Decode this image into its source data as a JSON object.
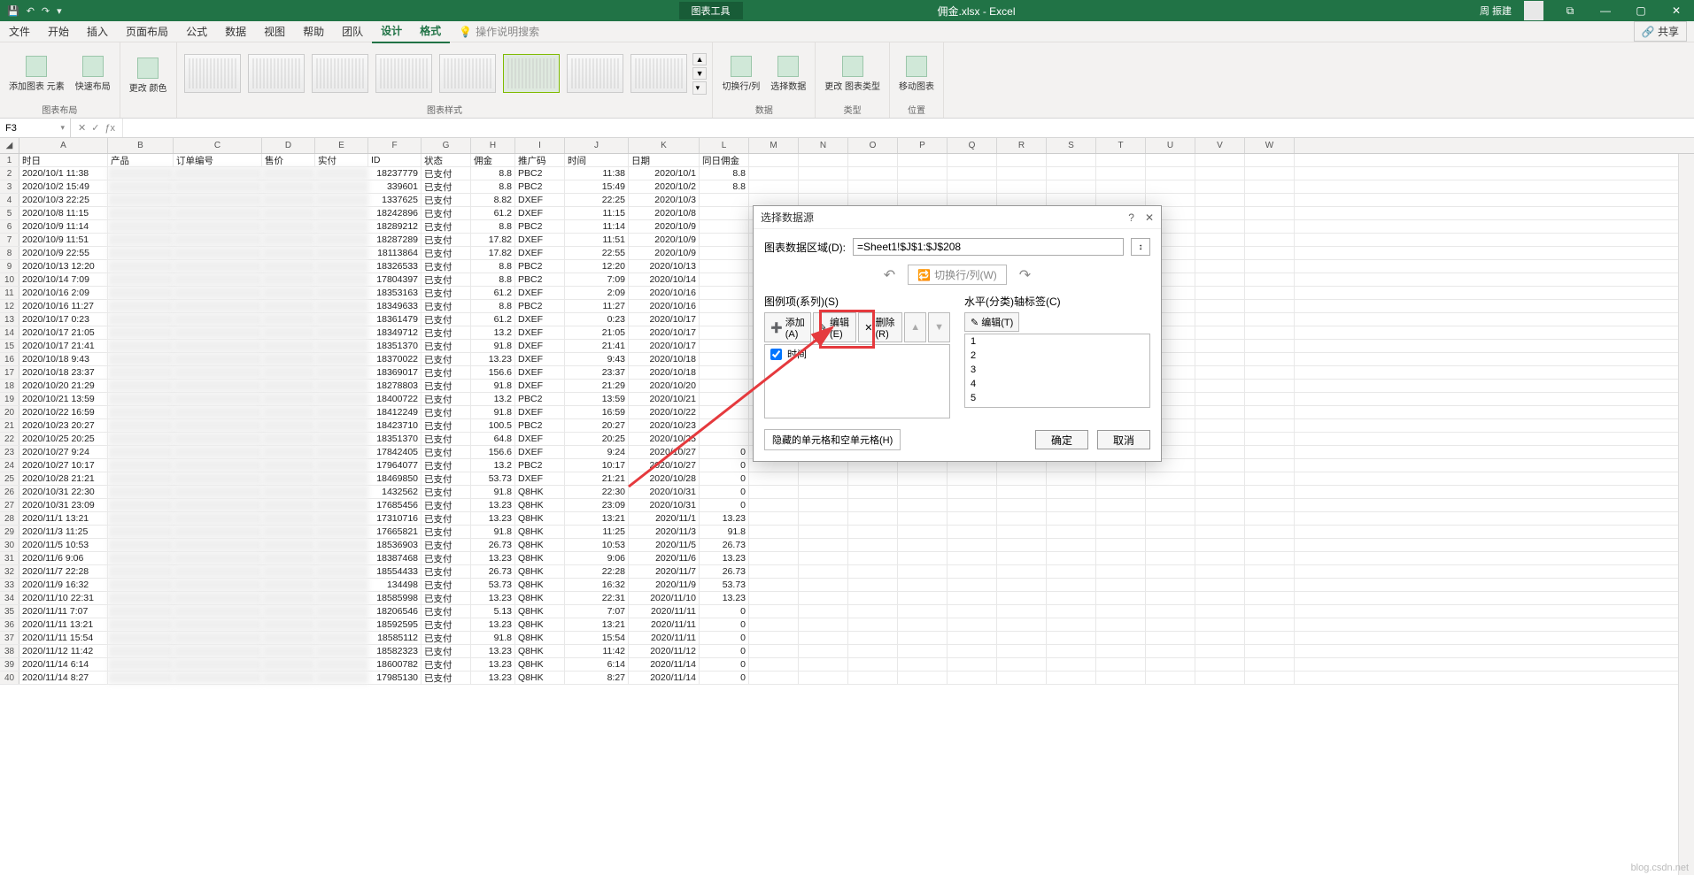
{
  "titlebar": {
    "chart_tool": "图表工具",
    "filename": "佣金.xlsx - Excel",
    "user": "周 振建",
    "win": {
      "min": "—",
      "max": "▢",
      "close": "✕",
      "restore": "⧉"
    }
  },
  "tabs": {
    "file": "文件",
    "home": "开始",
    "insert": "插入",
    "layout": "页面布局",
    "formula": "公式",
    "data": "数据",
    "view": "视图",
    "help": "帮助",
    "team": "团队",
    "design": "设计",
    "format": "格式",
    "tell_me": "操作说明搜索",
    "share": "共享"
  },
  "ribbon": {
    "grp_layout": "图表布局",
    "btn_add_el": "添加图表\n元素",
    "btn_quick": "快速布局",
    "btn_colors": "更改\n颜色",
    "grp_styles": "图表样式",
    "grp_data": "数据",
    "btn_switch": "切换行/列",
    "btn_select": "选择数据",
    "grp_type": "类型",
    "btn_change_type": "更改\n图表类型",
    "grp_loc": "位置",
    "btn_move": "移动图表"
  },
  "namebox": {
    "ref": "F3"
  },
  "columns": [
    "A",
    "B",
    "C",
    "D",
    "E",
    "F",
    "G",
    "H",
    "I",
    "J",
    "K",
    "L",
    "M",
    "N",
    "O",
    "P",
    "Q",
    "R",
    "S",
    "T",
    "U",
    "V",
    "W"
  ],
  "headers": {
    "A": "时日",
    "B": "产品",
    "C": "订单编号",
    "D": "售价",
    "E": "实付",
    "F": "ID",
    "G": "状态",
    "H": "佣金",
    "I": "推广码",
    "J": "时间",
    "K": "日期",
    "L": "同日佣金"
  },
  "rows": [
    {
      "n": 2,
      "A": "2020/10/1 11:38",
      "F": "18237779",
      "G": "已支付",
      "H": "8.8",
      "I": "PBC2",
      "J": "11:38",
      "K": "2020/10/1",
      "L": "8.8"
    },
    {
      "n": 3,
      "A": "2020/10/2 15:49",
      "F": "339601",
      "G": "已支付",
      "H": "8.8",
      "I": "PBC2",
      "J": "15:49",
      "K": "2020/10/2",
      "L": "8.8"
    },
    {
      "n": 4,
      "A": "2020/10/3 22:25",
      "F": "1337625",
      "G": "已支付",
      "H": "8.82",
      "I": "DXEF",
      "J": "22:25",
      "K": "2020/10/3",
      "L": ""
    },
    {
      "n": 5,
      "A": "2020/10/8 11:15",
      "F": "18242896",
      "G": "已支付",
      "H": "61.2",
      "I": "DXEF",
      "J": "11:15",
      "K": "2020/10/8",
      "L": ""
    },
    {
      "n": 6,
      "A": "2020/10/9 11:14",
      "F": "18289212",
      "G": "已支付",
      "H": "8.8",
      "I": "PBC2",
      "J": "11:14",
      "K": "2020/10/9",
      "L": ""
    },
    {
      "n": 7,
      "A": "2020/10/9 11:51",
      "F": "18287289",
      "G": "已支付",
      "H": "17.82",
      "I": "DXEF",
      "J": "11:51",
      "K": "2020/10/9",
      "L": ""
    },
    {
      "n": 8,
      "A": "2020/10/9 22:55",
      "F": "18113864",
      "G": "已支付",
      "H": "17.82",
      "I": "DXEF",
      "J": "22:55",
      "K": "2020/10/9",
      "L": ""
    },
    {
      "n": 9,
      "A": "2020/10/13 12:20",
      "F": "18326533",
      "G": "已支付",
      "H": "8.8",
      "I": "PBC2",
      "J": "12:20",
      "K": "2020/10/13",
      "L": ""
    },
    {
      "n": 10,
      "A": "2020/10/14 7:09",
      "F": "17804397",
      "G": "已支付",
      "H": "8.8",
      "I": "PBC2",
      "J": "7:09",
      "K": "2020/10/14",
      "L": ""
    },
    {
      "n": 11,
      "A": "2020/10/16 2:09",
      "F": "18353163",
      "G": "已支付",
      "H": "61.2",
      "I": "DXEF",
      "J": "2:09",
      "K": "2020/10/16",
      "L": ""
    },
    {
      "n": 12,
      "A": "2020/10/16 11:27",
      "F": "18349633",
      "G": "已支付",
      "H": "8.8",
      "I": "PBC2",
      "J": "11:27",
      "K": "2020/10/16",
      "L": ""
    },
    {
      "n": 13,
      "A": "2020/10/17 0:23",
      "F": "18361479",
      "G": "已支付",
      "H": "61.2",
      "I": "DXEF",
      "J": "0:23",
      "K": "2020/10/17",
      "L": ""
    },
    {
      "n": 14,
      "A": "2020/10/17 21:05",
      "F": "18349712",
      "G": "已支付",
      "H": "13.2",
      "I": "DXEF",
      "J": "21:05",
      "K": "2020/10/17",
      "L": ""
    },
    {
      "n": 15,
      "A": "2020/10/17 21:41",
      "F": "18351370",
      "G": "已支付",
      "H": "91.8",
      "I": "DXEF",
      "J": "21:41",
      "K": "2020/10/17",
      "L": ""
    },
    {
      "n": 16,
      "A": "2020/10/18 9:43",
      "F": "18370022",
      "G": "已支付",
      "H": "13.23",
      "I": "DXEF",
      "J": "9:43",
      "K": "2020/10/18",
      "L": ""
    },
    {
      "n": 17,
      "A": "2020/10/18 23:37",
      "F": "18369017",
      "G": "已支付",
      "H": "156.6",
      "I": "DXEF",
      "J": "23:37",
      "K": "2020/10/18",
      "L": ""
    },
    {
      "n": 18,
      "A": "2020/10/20 21:29",
      "F": "18278803",
      "G": "已支付",
      "H": "91.8",
      "I": "DXEF",
      "J": "21:29",
      "K": "2020/10/20",
      "L": ""
    },
    {
      "n": 19,
      "A": "2020/10/21 13:59",
      "F": "18400722",
      "G": "已支付",
      "H": "13.2",
      "I": "PBC2",
      "J": "13:59",
      "K": "2020/10/21",
      "L": ""
    },
    {
      "n": 20,
      "A": "2020/10/22 16:59",
      "F": "18412249",
      "G": "已支付",
      "H": "91.8",
      "I": "DXEF",
      "J": "16:59",
      "K": "2020/10/22",
      "L": ""
    },
    {
      "n": 21,
      "A": "2020/10/23 20:27",
      "F": "18423710",
      "G": "已支付",
      "H": "100.5",
      "I": "PBC2",
      "J": "20:27",
      "K": "2020/10/23",
      "L": ""
    },
    {
      "n": 22,
      "A": "2020/10/25 20:25",
      "F": "18351370",
      "G": "已支付",
      "H": "64.8",
      "I": "DXEF",
      "J": "20:25",
      "K": "2020/10/25",
      "L": ""
    },
    {
      "n": 23,
      "A": "2020/10/27 9:24",
      "F": "17842405",
      "G": "已支付",
      "H": "156.6",
      "I": "DXEF",
      "J": "9:24",
      "K": "2020/10/27",
      "L": "0"
    },
    {
      "n": 24,
      "A": "2020/10/27 10:17",
      "F": "17964077",
      "G": "已支付",
      "H": "13.2",
      "I": "PBC2",
      "J": "10:17",
      "K": "2020/10/27",
      "L": "0"
    },
    {
      "n": 25,
      "A": "2020/10/28 21:21",
      "F": "18469850",
      "G": "已支付",
      "H": "53.73",
      "I": "DXEF",
      "J": "21:21",
      "K": "2020/10/28",
      "L": "0"
    },
    {
      "n": 26,
      "A": "2020/10/31 22:30",
      "F": "1432562",
      "G": "已支付",
      "H": "91.8",
      "I": "Q8HK",
      "J": "22:30",
      "K": "2020/10/31",
      "L": "0"
    },
    {
      "n": 27,
      "A": "2020/10/31 23:09",
      "F": "17685456",
      "G": "已支付",
      "H": "13.23",
      "I": "Q8HK",
      "J": "23:09",
      "K": "2020/10/31",
      "L": "0"
    },
    {
      "n": 28,
      "A": "2020/11/1 13:21",
      "F": "17310716",
      "G": "已支付",
      "H": "13.23",
      "I": "Q8HK",
      "J": "13:21",
      "K": "2020/11/1",
      "L": "13.23"
    },
    {
      "n": 29,
      "A": "2020/11/3 11:25",
      "F": "17665821",
      "G": "已支付",
      "H": "91.8",
      "I": "Q8HK",
      "J": "11:25",
      "K": "2020/11/3",
      "L": "91.8"
    },
    {
      "n": 30,
      "A": "2020/11/5 10:53",
      "F": "18536903",
      "G": "已支付",
      "H": "26.73",
      "I": "Q8HK",
      "J": "10:53",
      "K": "2020/11/5",
      "L": "26.73"
    },
    {
      "n": 31,
      "A": "2020/11/6 9:06",
      "F": "18387468",
      "G": "已支付",
      "H": "13.23",
      "I": "Q8HK",
      "J": "9:06",
      "K": "2020/11/6",
      "L": "13.23"
    },
    {
      "n": 32,
      "A": "2020/11/7 22:28",
      "F": "18554433",
      "G": "已支付",
      "H": "26.73",
      "I": "Q8HK",
      "J": "22:28",
      "K": "2020/11/7",
      "L": "26.73"
    },
    {
      "n": 33,
      "A": "2020/11/9 16:32",
      "F": "134498",
      "G": "已支付",
      "H": "53.73",
      "I": "Q8HK",
      "J": "16:32",
      "K": "2020/11/9",
      "L": "53.73"
    },
    {
      "n": 34,
      "A": "2020/11/10 22:31",
      "F": "18585998",
      "G": "已支付",
      "H": "13.23",
      "I": "Q8HK",
      "J": "22:31",
      "K": "2020/11/10",
      "L": "13.23"
    },
    {
      "n": 35,
      "A": "2020/11/11 7:07",
      "F": "18206546",
      "G": "已支付",
      "H": "5.13",
      "I": "Q8HK",
      "J": "7:07",
      "K": "2020/11/11",
      "L": "0"
    },
    {
      "n": 36,
      "A": "2020/11/11 13:21",
      "F": "18592595",
      "G": "已支付",
      "H": "13.23",
      "I": "Q8HK",
      "J": "13:21",
      "K": "2020/11/11",
      "L": "0"
    },
    {
      "n": 37,
      "A": "2020/11/11 15:54",
      "F": "18585112",
      "G": "已支付",
      "H": "91.8",
      "I": "Q8HK",
      "J": "15:54",
      "K": "2020/11/11",
      "L": "0"
    },
    {
      "n": 38,
      "A": "2020/11/12 11:42",
      "F": "18582323",
      "G": "已支付",
      "H": "13.23",
      "I": "Q8HK",
      "J": "11:42",
      "K": "2020/11/12",
      "L": "0"
    },
    {
      "n": 39,
      "A": "2020/11/14 6:14",
      "F": "18600782",
      "G": "已支付",
      "H": "13.23",
      "I": "Q8HK",
      "J": "6:14",
      "K": "2020/11/14",
      "L": "0"
    },
    {
      "n": 40,
      "A": "2020/11/14 8:27",
      "F": "17985130",
      "G": "已支付",
      "H": "13.23",
      "I": "Q8HK",
      "J": "8:27",
      "K": "2020/11/14",
      "L": "0"
    }
  ],
  "dialog": {
    "title": "选择数据源",
    "range_label": "图表数据区域(D):",
    "range_value": "=Sheet1!$J$1:$J$208",
    "switch": "切换行/列(W)",
    "legend_label": "图例项(系列)(S)",
    "axis_label": "水平(分类)轴标签(C)",
    "add": "添加(A)",
    "edit": "编辑(E)",
    "edit2": "编辑(T)",
    "remove": "删除(R)",
    "series0": "时间",
    "axis_items": [
      "1",
      "2",
      "3",
      "4",
      "5"
    ],
    "hidden": "隐藏的单元格和空单元格(H)",
    "ok": "确定",
    "cancel": "取消"
  },
  "watermark": "blog.csdn.net"
}
